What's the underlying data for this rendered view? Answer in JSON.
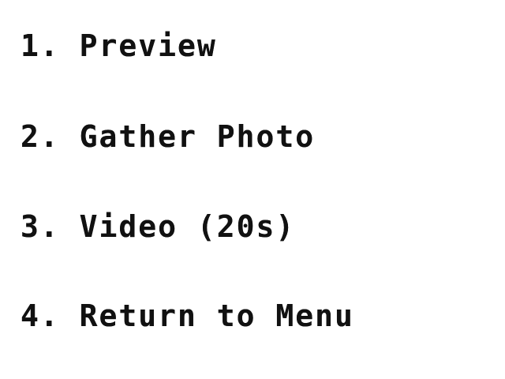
{
  "menu": {
    "items": [
      {
        "label": "1. Preview"
      },
      {
        "label": "2. Gather Photo"
      },
      {
        "label": "3. Video (20s)"
      },
      {
        "label": "4. Return to Menu"
      }
    ]
  },
  "colors": {
    "background": "#ffffff",
    "text": "#111111"
  }
}
